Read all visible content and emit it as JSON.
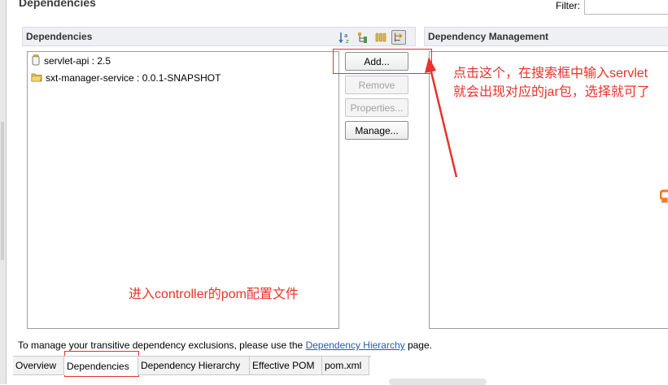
{
  "header": {
    "title": "Dependencies",
    "filter_label": "Filter:",
    "filter_value": ""
  },
  "dependencies_section": {
    "title": "Dependencies",
    "toolbar_icons": [
      "sort-alpha-icon",
      "hierarchy-icon",
      "columns-icon",
      "toggle-view-icon"
    ],
    "items": [
      {
        "label": "servlet-api : 2.5",
        "icon": "jar-icon"
      },
      {
        "label": "sxt-manager-service : 0.0.1-SNAPSHOT",
        "icon": "folder-project-icon"
      }
    ],
    "buttons": {
      "add": "Add...",
      "remove": "Remove",
      "properties": "Properties...",
      "manage": "Manage..."
    }
  },
  "management_section": {
    "title": "Dependency Management"
  },
  "annotations": {
    "line1": "点击这个，在搜索框中输入servlet",
    "line2": "就会出现对应的jar包，选择就可了",
    "controller_note": "进入controller的pom配置文件",
    "color": "#e8322a"
  },
  "hint": {
    "before": "To manage your transitive dependency exclusions, please use the ",
    "link": "Dependency Hierarchy",
    "after": " page."
  },
  "tabs": [
    {
      "label": "Overview",
      "active": false
    },
    {
      "label": "Dependencies",
      "active": true
    },
    {
      "label": "Dependency Hierarchy",
      "active": false
    },
    {
      "label": "Effective POM",
      "active": false
    },
    {
      "label": "pom.xml",
      "active": false
    }
  ],
  "colors": {
    "link": "#1a5fb4",
    "section_header_bg": "#eef0f3",
    "accent_orange": "#f07a28"
  }
}
